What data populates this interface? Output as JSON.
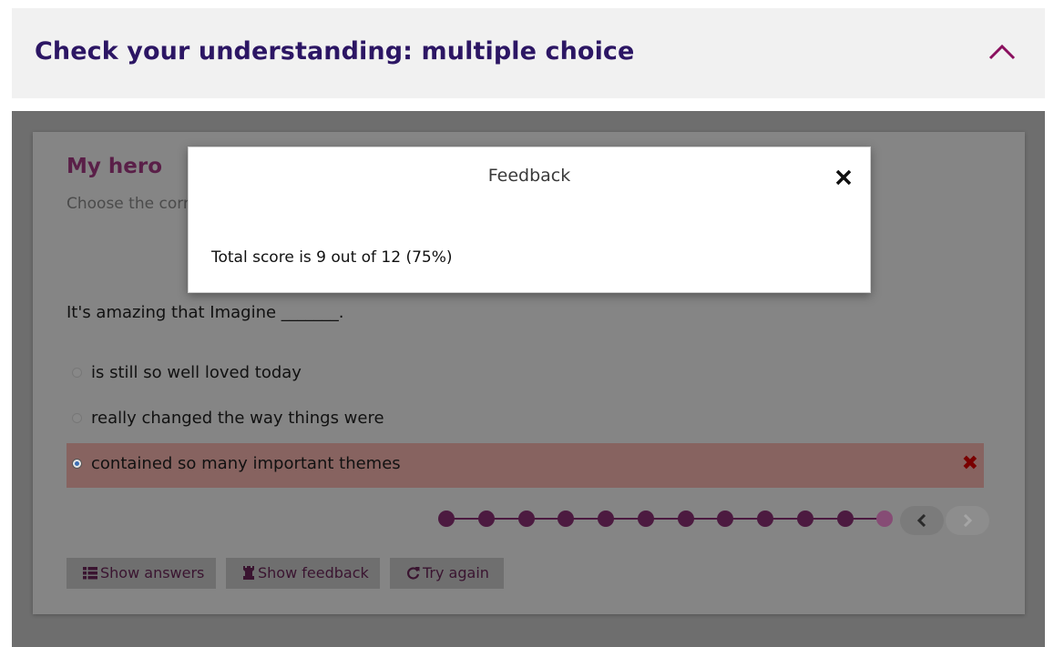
{
  "accordion": {
    "title": "Check your understanding: multiple choice",
    "toggle_icon": "chevron-up-icon",
    "accent_color": "#8a0f5e"
  },
  "activity": {
    "title": "My hero",
    "instruction": "Choose the corr",
    "question": "It's amazing that Imagine _______.",
    "options": [
      {
        "label": "is still so well loved today",
        "selected": false
      },
      {
        "label": "really changed the way things were",
        "selected": false
      },
      {
        "label": "contained so many important themes",
        "selected": true,
        "result": "incorrect"
      }
    ],
    "progress": {
      "total": 12,
      "current": 12
    },
    "navigation": {
      "previous_icon": "chevron-left-icon",
      "next_icon": "chevron-right-icon",
      "next_disabled": true
    },
    "buttons": {
      "show_answers": "Show answers",
      "show_feedback": "Show feedback",
      "try_again": "Try again"
    }
  },
  "feedback_modal": {
    "title": "Feedback",
    "close_icon": "close-icon",
    "body": "Total score is 9 out of 12 (75%)"
  }
}
